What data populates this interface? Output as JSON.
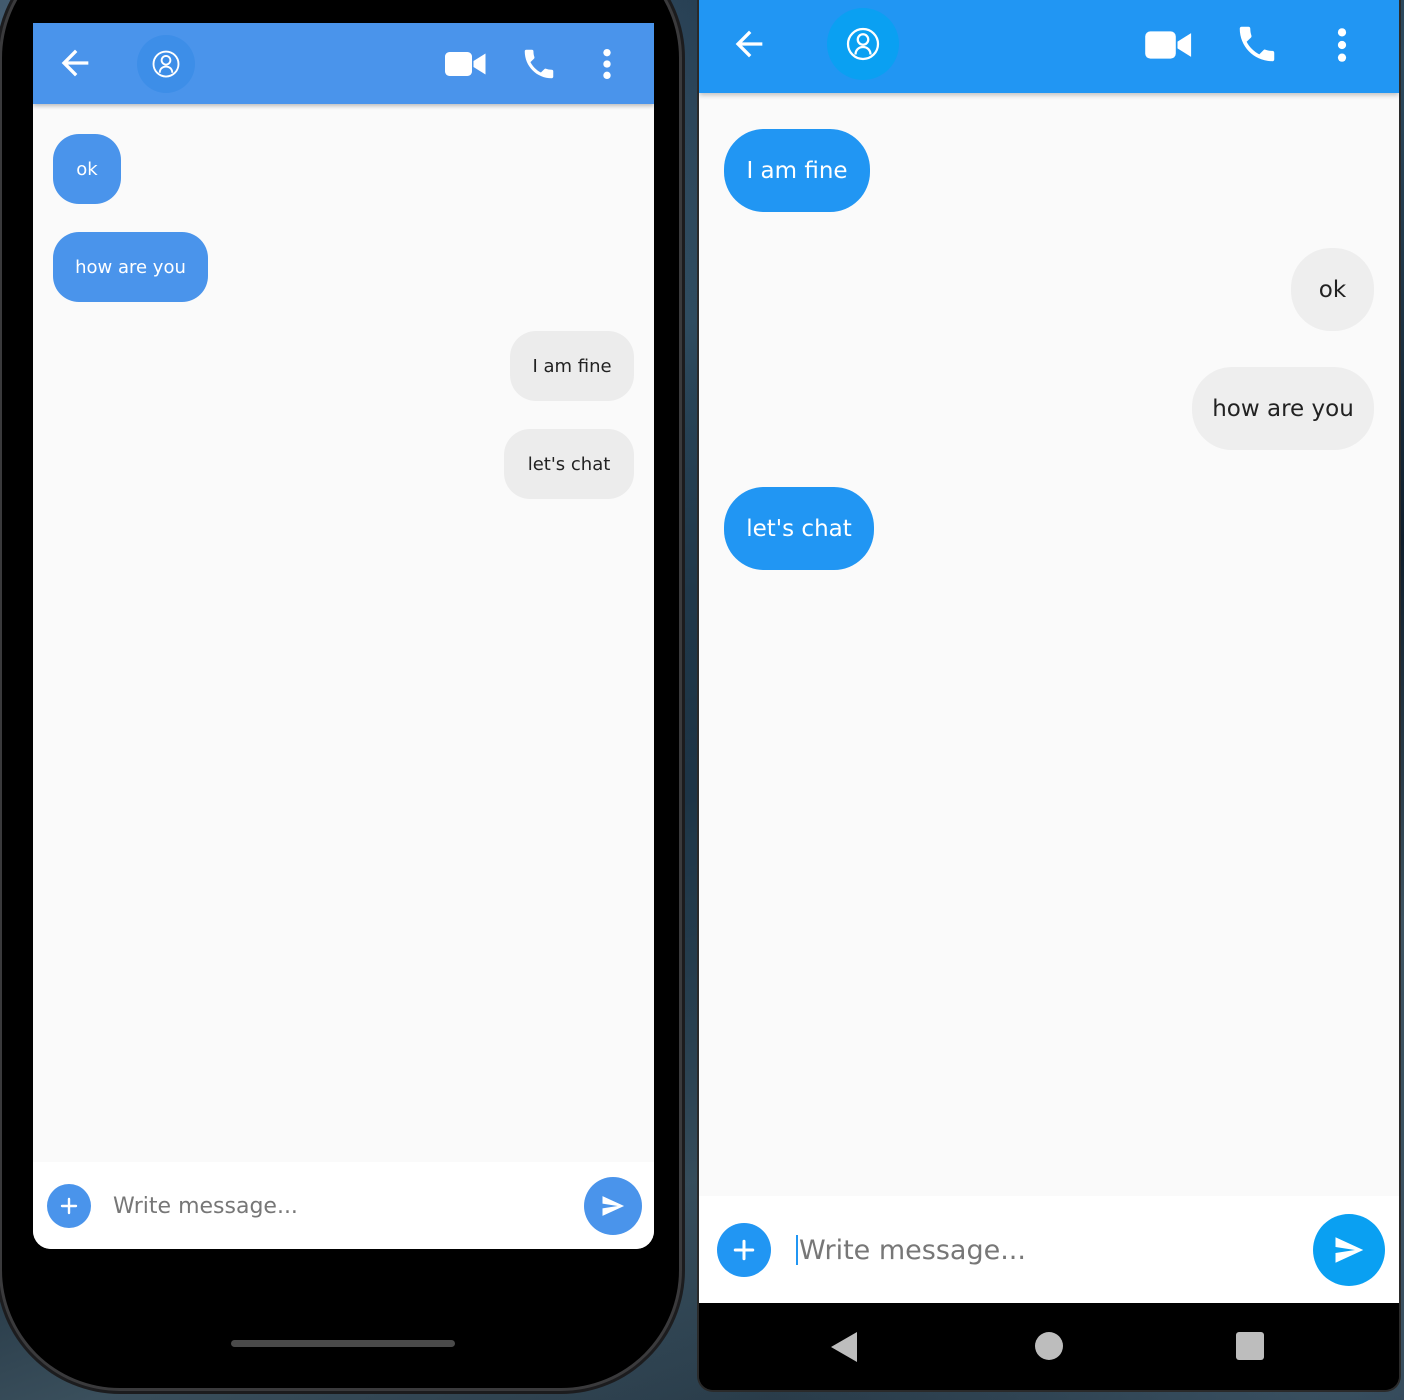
{
  "ios": {
    "header": {},
    "messages": [
      {
        "text": "ok",
        "type": "sent"
      },
      {
        "text": "how are you",
        "type": "sent"
      },
      {
        "text": "I am fine",
        "type": "received"
      },
      {
        "text": "let's chat",
        "type": "received"
      }
    ],
    "input": {
      "placeholder": "Write message..."
    }
  },
  "android": {
    "header": {},
    "messages": [
      {
        "text": "I am fine",
        "type": "sent"
      },
      {
        "text": "ok",
        "type": "received"
      },
      {
        "text": "how are you",
        "type": "received"
      },
      {
        "text": "let's chat",
        "type": "sent"
      }
    ],
    "input": {
      "placeholder": "Write message..."
    }
  },
  "icons": {
    "back": "arrow-back-icon",
    "avatar": "person-icon",
    "video": "videocam-icon",
    "call": "phone-icon",
    "more": "more-vert-icon",
    "add": "add-icon",
    "send": "send-icon"
  },
  "colors": {
    "ios_primary": "#4a94eb",
    "android_primary": "#2196f3",
    "android_accent": "#0aa0f2",
    "received_bubble": "#eeeeee",
    "background": "#fafafa"
  }
}
